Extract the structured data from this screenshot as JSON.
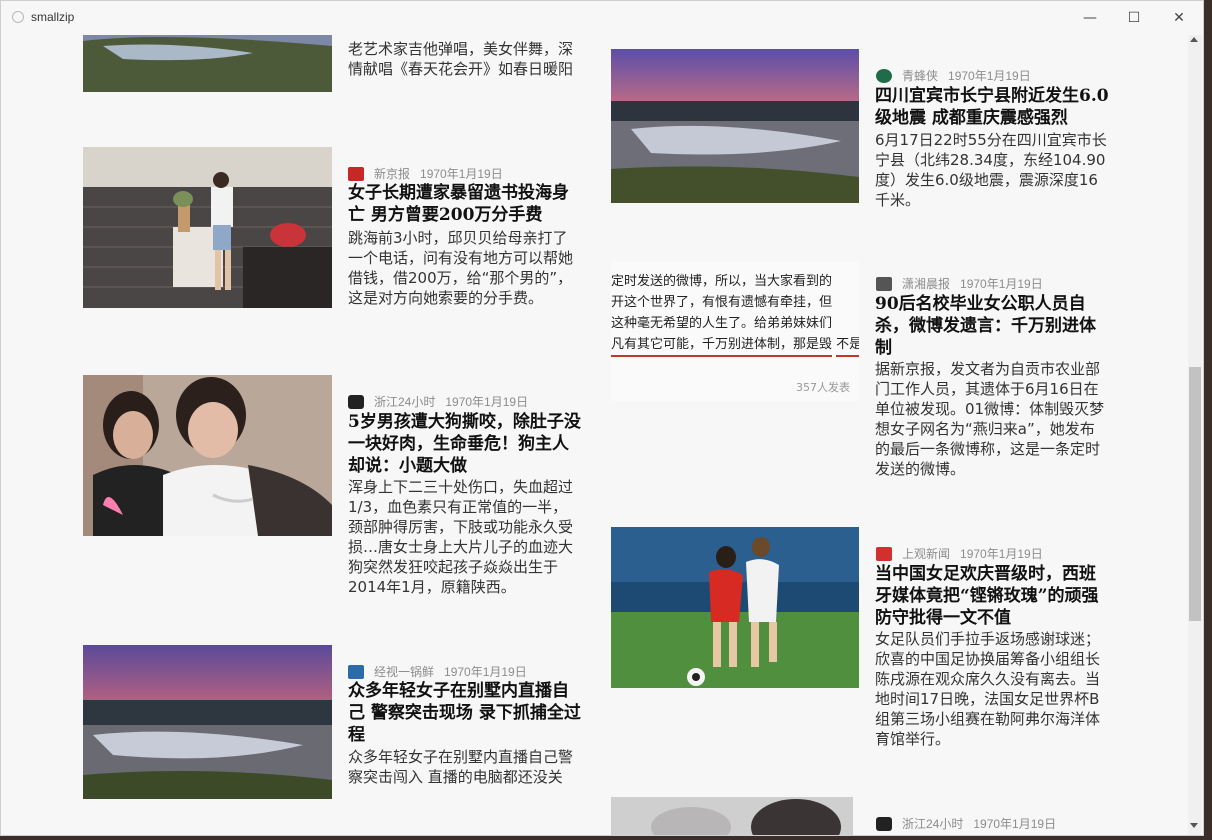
{
  "window": {
    "title": "smallzip",
    "minimize_glyph": "—",
    "maximize_glyph": "☐",
    "close_glyph": "✕"
  },
  "feed": {
    "left": [
      {
        "source": "",
        "date": "",
        "title": "",
        "summary": "老艺术家吉他弹唱，美女伴舞，深情献唱《春天花会开》如春日暖阳",
        "thumb": "sunset-landscape"
      },
      {
        "source": "新京报",
        "date": "1970年1月19日",
        "title": "女子长期遭家暴留遗书投海身亡 男方曾要200万分手费",
        "summary": "跳海前3小时，邱贝贝给母亲打了一个电话，问有没有地方可以帮她借钱，借200万，给“那个男的”，这是对方向她索要的分手费。",
        "thumb": "woman-at-table"
      },
      {
        "source": "浙江24小时",
        "date": "1970年1月19日",
        "title": "5岁男孩遭大狗撕咬，除肚子没一块好肉，生命垂危！狗主人却说：小题大做",
        "summary": "浑身上下二三十处伤口，失血超过1/3，血色素只有正常值的一半，颈部肿得厉害，下肢或功能永久受损…唐女士身上大片儿子的血迹大狗突然发狂咬起孩子焱焱出生于2014年1月，原籍陕西。",
        "thumb": "two-women"
      },
      {
        "source": "经视一锅鲜",
        "date": "1970年1月19日",
        "title": "众多年轻女子在别墅内直播自己 警察突击现场 录下抓捕全过程",
        "summary": "众多年轻女子在别墅内直播自己警察突击闯入 直播的电脑都还没关",
        "thumb": "sunset-landscape"
      }
    ],
    "right": [
      {
        "source": "青蜂侠",
        "date": "1970年1月19日",
        "title": "四川宜宾市长宁县附近发生6.0级地震 成都重庆震感强烈",
        "summary": "6月17日22时55分在四川宜宾市长宁县（北纬28.34度，东经104.90度）发生6.0级地震，震源深度16千米。",
        "thumb": "sunset-landscape"
      },
      {
        "source": "潇湘晨报",
        "date": "1970年1月19日",
        "title": "90后名校毕业女公职人员自杀，微博发遗言：千万别进体制",
        "summary": "据新京报，发文者为自贡市农业部门工作人员，其遗体于6月16日在单位被发现。01微博：体制毁灭梦想女子网名为“燕归来a”，她发布的最后一条微博称，这是一条定时发送的微博。",
        "thumb": "weibo-screenshot"
      },
      {
        "source": "上观新闻",
        "date": "1970年1月19日",
        "title": "当中国女足欢庆晋级时，西班牙媒体竟把“铿锵玫瑰”的顽强防守批得一文不值",
        "summary": "女足队员们手拉手返场感谢球迷；欣喜的中国足协换届筹备小组组长陈戌源在观众席久久没有离去。当地时间17日晚，法国女足世界杯B组第三场小组赛在勒阿弗尔海洋体育馆举行。",
        "thumb": "soccer-match"
      },
      {
        "source": "浙江24小时",
        "date": "1970年1月19日",
        "title": "",
        "summary": "",
        "thumb": "partial-photo"
      }
    ]
  },
  "screenshot_text": {
    "lines": [
      "定时发送的微博，所以，当大家看到的",
      "开这个世界了，有恨有遗憾有牵挂，但",
      "这种毫无希望的人生了。给弟弟妹妹们",
      "凡有其它可能，千万别进体制，那是毁",
      "不是开玩笑。"
    ],
    "footer": "357人发表",
    "highlight": "千万别进体制"
  },
  "colors": {
    "accent_red": "#c0392b",
    "background": "#f7f7f7"
  }
}
